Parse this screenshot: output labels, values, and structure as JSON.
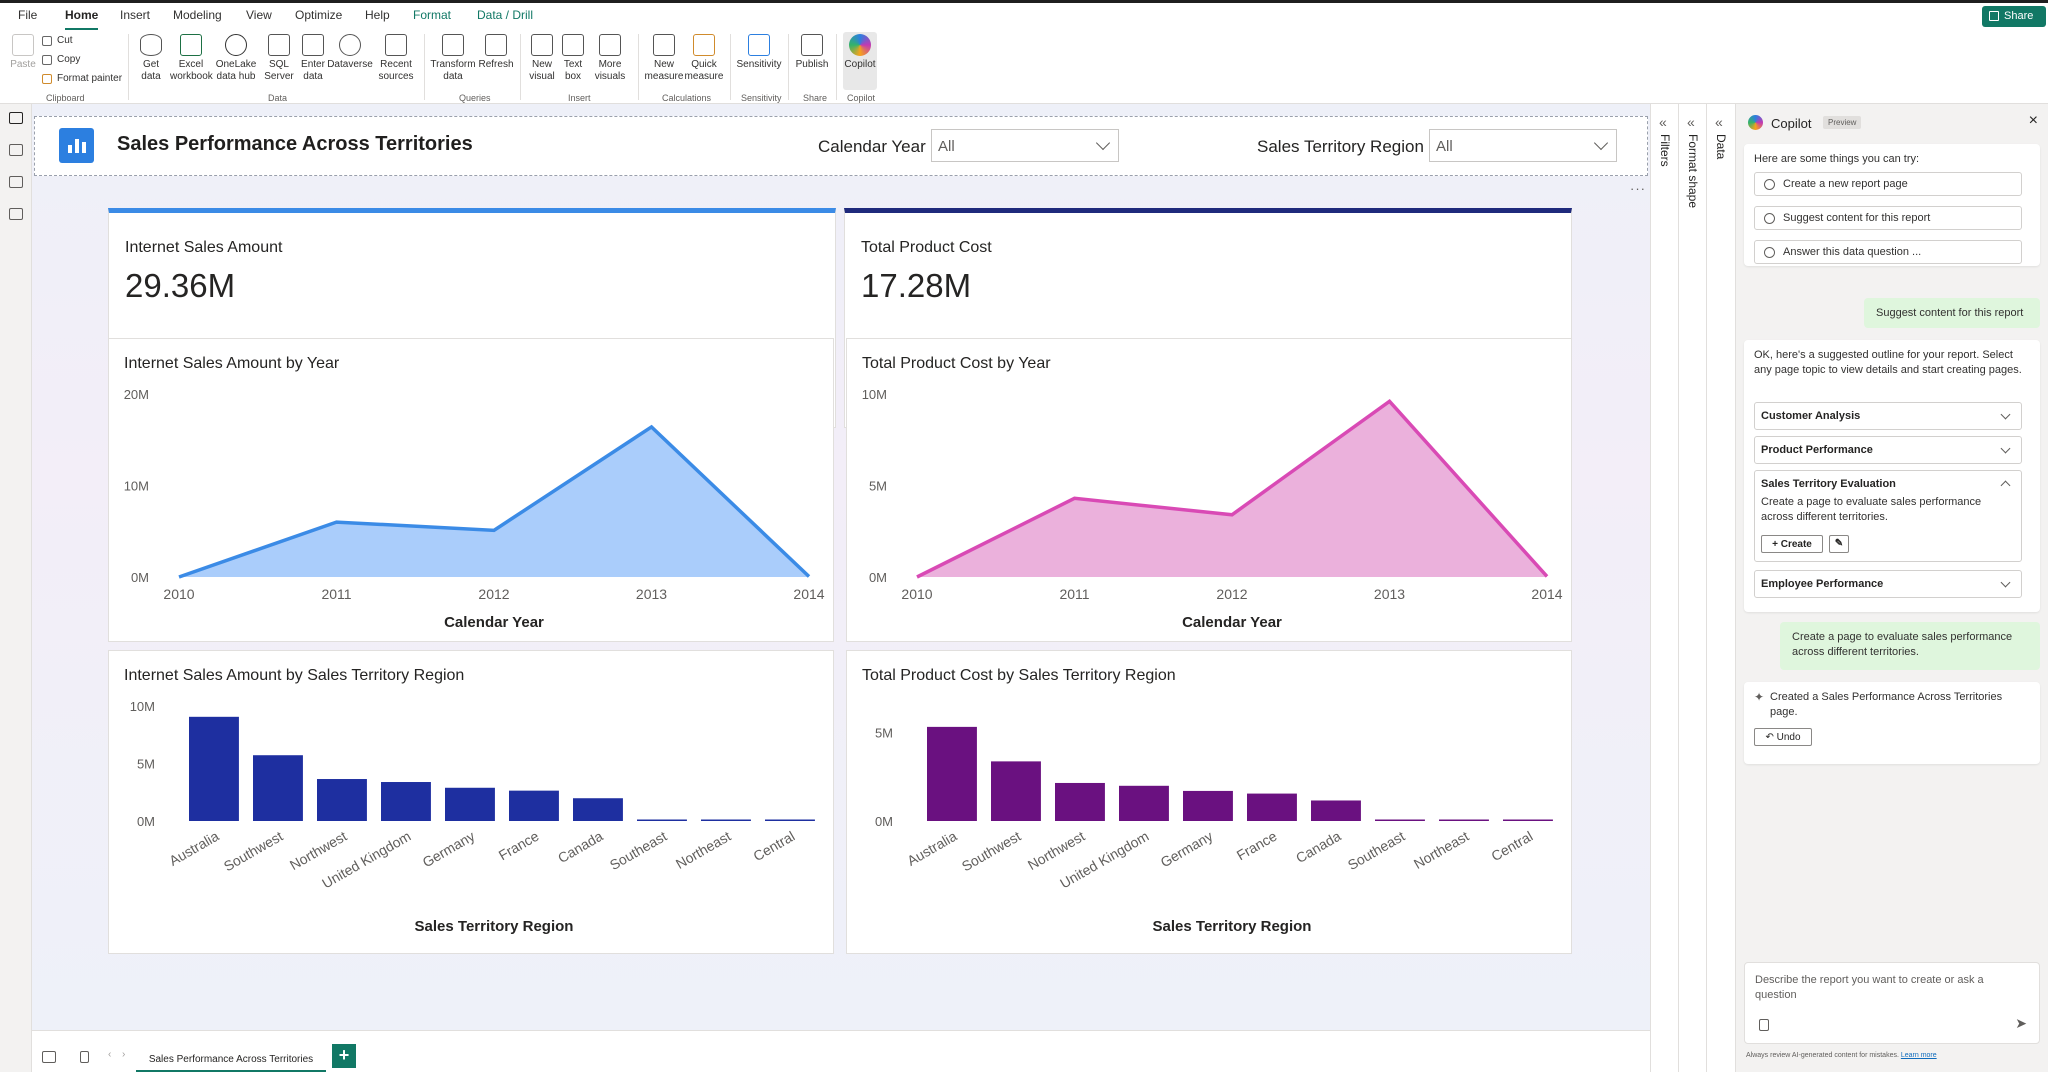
{
  "menu": {
    "tabs": [
      "File",
      "Home",
      "Insert",
      "Modeling",
      "View",
      "Optimize",
      "Help",
      "Format",
      "Data / Drill"
    ],
    "active": "Home",
    "share": "Share"
  },
  "ribbon": {
    "clipboard": {
      "paste": "Paste",
      "cut": "Cut",
      "copy": "Copy",
      "format_painter": "Format painter",
      "group": "Clipboard"
    },
    "data": {
      "get_data": "Get data",
      "excel": "Excel workbook",
      "onelake": "OneLake data hub",
      "sql": "SQL Server",
      "enter": "Enter data",
      "dataverse": "Dataverse",
      "recent": "Recent sources",
      "group": "Data"
    },
    "queries": {
      "transform": "Transform data",
      "refresh": "Refresh",
      "group": "Queries"
    },
    "insert": {
      "new_visual": "New visual",
      "text_box": "Text box",
      "more_visuals": "More visuals",
      "group": "Insert"
    },
    "calculations": {
      "new_measure": "New measure",
      "quick_measure": "Quick measure",
      "group": "Calculations"
    },
    "sensitivity": {
      "label": "Sensitivity",
      "group": "Sensitivity"
    },
    "share": {
      "publish": "Publish",
      "group": "Share"
    },
    "copilot": {
      "label": "Copilot",
      "group": "Copilot"
    }
  },
  "report": {
    "title": "Sales Performance Across Territories",
    "slicers": [
      {
        "label": "Calendar Year",
        "value": "All"
      },
      {
        "label": "Sales Territory Region",
        "value": "All"
      }
    ],
    "kpis": [
      {
        "label": "Internet Sales Amount",
        "value": "29.36M",
        "accent": "#3b8be6"
      },
      {
        "label": "Total Product Cost",
        "value": "17.28M",
        "accent": "#1f2a7c"
      }
    ]
  },
  "chart_data": [
    {
      "type": "area",
      "title": "Internet Sales Amount by Year",
      "xlabel": "Calendar Year",
      "x": [
        2010,
        2011,
        2012,
        2013,
        2014
      ],
      "values": [
        0,
        6.0,
        5.1,
        16.4,
        0.05
      ],
      "unit": "M",
      "ylim": [
        0,
        20
      ],
      "yticks": [
        "0M",
        "10M",
        "20M"
      ],
      "color": "#3b8be6",
      "fill": "#aacdfb"
    },
    {
      "type": "area",
      "title": "Total Product Cost by Year",
      "xlabel": "Calendar Year",
      "x": [
        2010,
        2011,
        2012,
        2013,
        2014
      ],
      "values": [
        0,
        4.3,
        3.4,
        9.6,
        0.03
      ],
      "unit": "M",
      "ylim": [
        0,
        10
      ],
      "yticks": [
        "0M",
        "5M",
        "10M"
      ],
      "color": "#d94ab5",
      "fill": "#ebb1dc"
    },
    {
      "type": "bar",
      "title": "Internet Sales Amount by Sales Territory Region",
      "xlabel": "Sales Territory Region",
      "categories": [
        "Australia",
        "Southwest",
        "Northwest",
        "United Kingdom",
        "Germany",
        "France",
        "Canada",
        "Southeast",
        "Northeast",
        "Central"
      ],
      "values": [
        9.06,
        5.72,
        3.65,
        3.39,
        2.89,
        2.64,
        1.98,
        0.01,
        0.01,
        0.01
      ],
      "ylim": [
        0,
        10
      ],
      "yticks": [
        "0M",
        "5M",
        "10M"
      ],
      "color": "#1e2fa0"
    },
    {
      "type": "bar",
      "title": "Total Product Cost by Sales Territory Region",
      "xlabel": "Sales Territory Region",
      "categories": [
        "Australia",
        "Southwest",
        "Northwest",
        "United Kingdom",
        "Germany",
        "France",
        "Canada",
        "Southeast",
        "Northeast",
        "Central"
      ],
      "values": [
        5.32,
        3.37,
        2.15,
        1.99,
        1.7,
        1.55,
        1.16,
        0.01,
        0.01,
        0.01
      ],
      "ylim": [
        0,
        6.5
      ],
      "yticks": [
        "0M",
        "5M"
      ],
      "color": "#6a1180"
    }
  ],
  "bottom": {
    "page_tab": "Sales Performance Across Territories",
    "add": "+"
  },
  "panes": {
    "filters": "Filters",
    "format": "Format shape",
    "data": "Data"
  },
  "copilot": {
    "title": "Copilot",
    "badge": "Preview",
    "intro": "Here are some things you can try:",
    "suggestions": [
      "Create a new report page",
      "Suggest content for this report",
      "Answer this data question ..."
    ],
    "user_msg1": "Suggest content for this report",
    "outline_intro": "OK, here's a suggested outline for your report. Select any page topic to view details and start creating pages.",
    "topics": [
      "Customer Analysis",
      "Product Performance",
      "Sales Territory Evaluation",
      "Employee Performance"
    ],
    "topic_detail": "Create a page to evaluate sales performance across different territories.",
    "create": "Create",
    "user_msg2": "Create a page to evaluate sales performance across different territories.",
    "created": "Created a Sales Performance Across Territories page.",
    "undo": "Undo",
    "input_placeholder": "Describe the report you want to create or ask a question",
    "footer": "Always review AI-generated content for mistakes.",
    "learn_more": "Learn more"
  }
}
